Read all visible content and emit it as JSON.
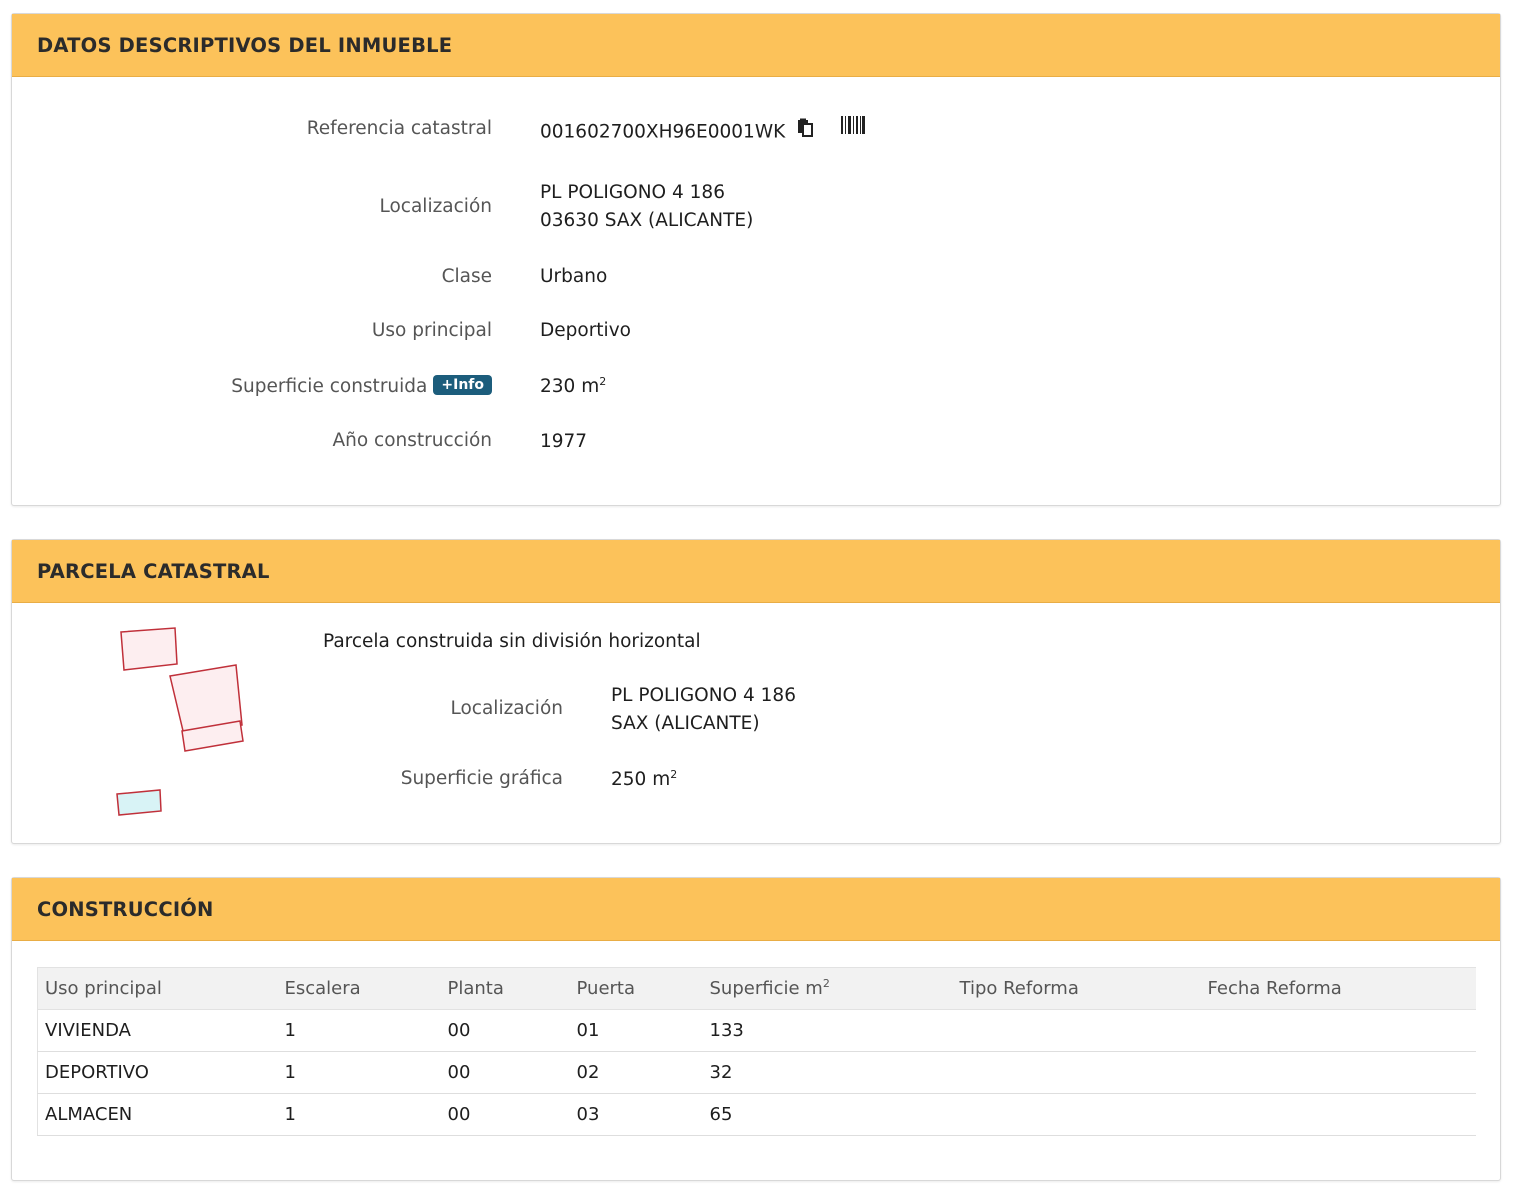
{
  "datos": {
    "title": "DATOS DESCRIPTIVOS DEL INMUEBLE",
    "ref_label": "Referencia catastral",
    "ref_value": "001602700XH96E0001WK",
    "loc_label": "Localización",
    "loc_line1": "PL POLIGONO 4 186",
    "loc_line2": "03630 SAX (ALICANTE)",
    "clase_label": "Clase",
    "clase_value": "Urbano",
    "uso_label": "Uso principal",
    "uso_value": "Deportivo",
    "sup_label": "Superficie construida",
    "info_badge": "+Info",
    "sup_value": "230 m",
    "sup_exp": "2",
    "anio_label": "Año construcción",
    "anio_value": "1977"
  },
  "parcela": {
    "title": "PARCELA CATASTRAL",
    "subtitle": "Parcela construida sin división horizontal",
    "loc_label": "Localización",
    "loc_line1": "PL POLIGONO 4 186",
    "loc_line2": "SAX (ALICANTE)",
    "sup_label": "Superficie gráfica",
    "sup_value": "250 m",
    "sup_exp": "2"
  },
  "construccion": {
    "title": "CONSTRUCCIÓN",
    "headers": [
      "Uso principal",
      "Escalera",
      "Planta",
      "Puerta",
      "Superficie m",
      "Tipo Reforma",
      "Fecha Reforma"
    ],
    "sup_exp": "2",
    "rows": [
      [
        "VIVIENDA",
        "1",
        "00",
        "01",
        "133",
        "",
        ""
      ],
      [
        "DEPORTIVO",
        "1",
        "00",
        "02",
        "32",
        "",
        ""
      ],
      [
        "ALMACEN",
        "1",
        "00",
        "03",
        "65",
        "",
        ""
      ]
    ]
  },
  "colors": {
    "header_bg": "#fcc25a",
    "badge_bg": "#1c5d7c",
    "parcel_stroke": "#c0303a",
    "parcel_fill": "#fdeef0",
    "parcel_small_fill": "#d8f3f6"
  },
  "icons": [
    "copy-icon",
    "barcode-icon"
  ]
}
